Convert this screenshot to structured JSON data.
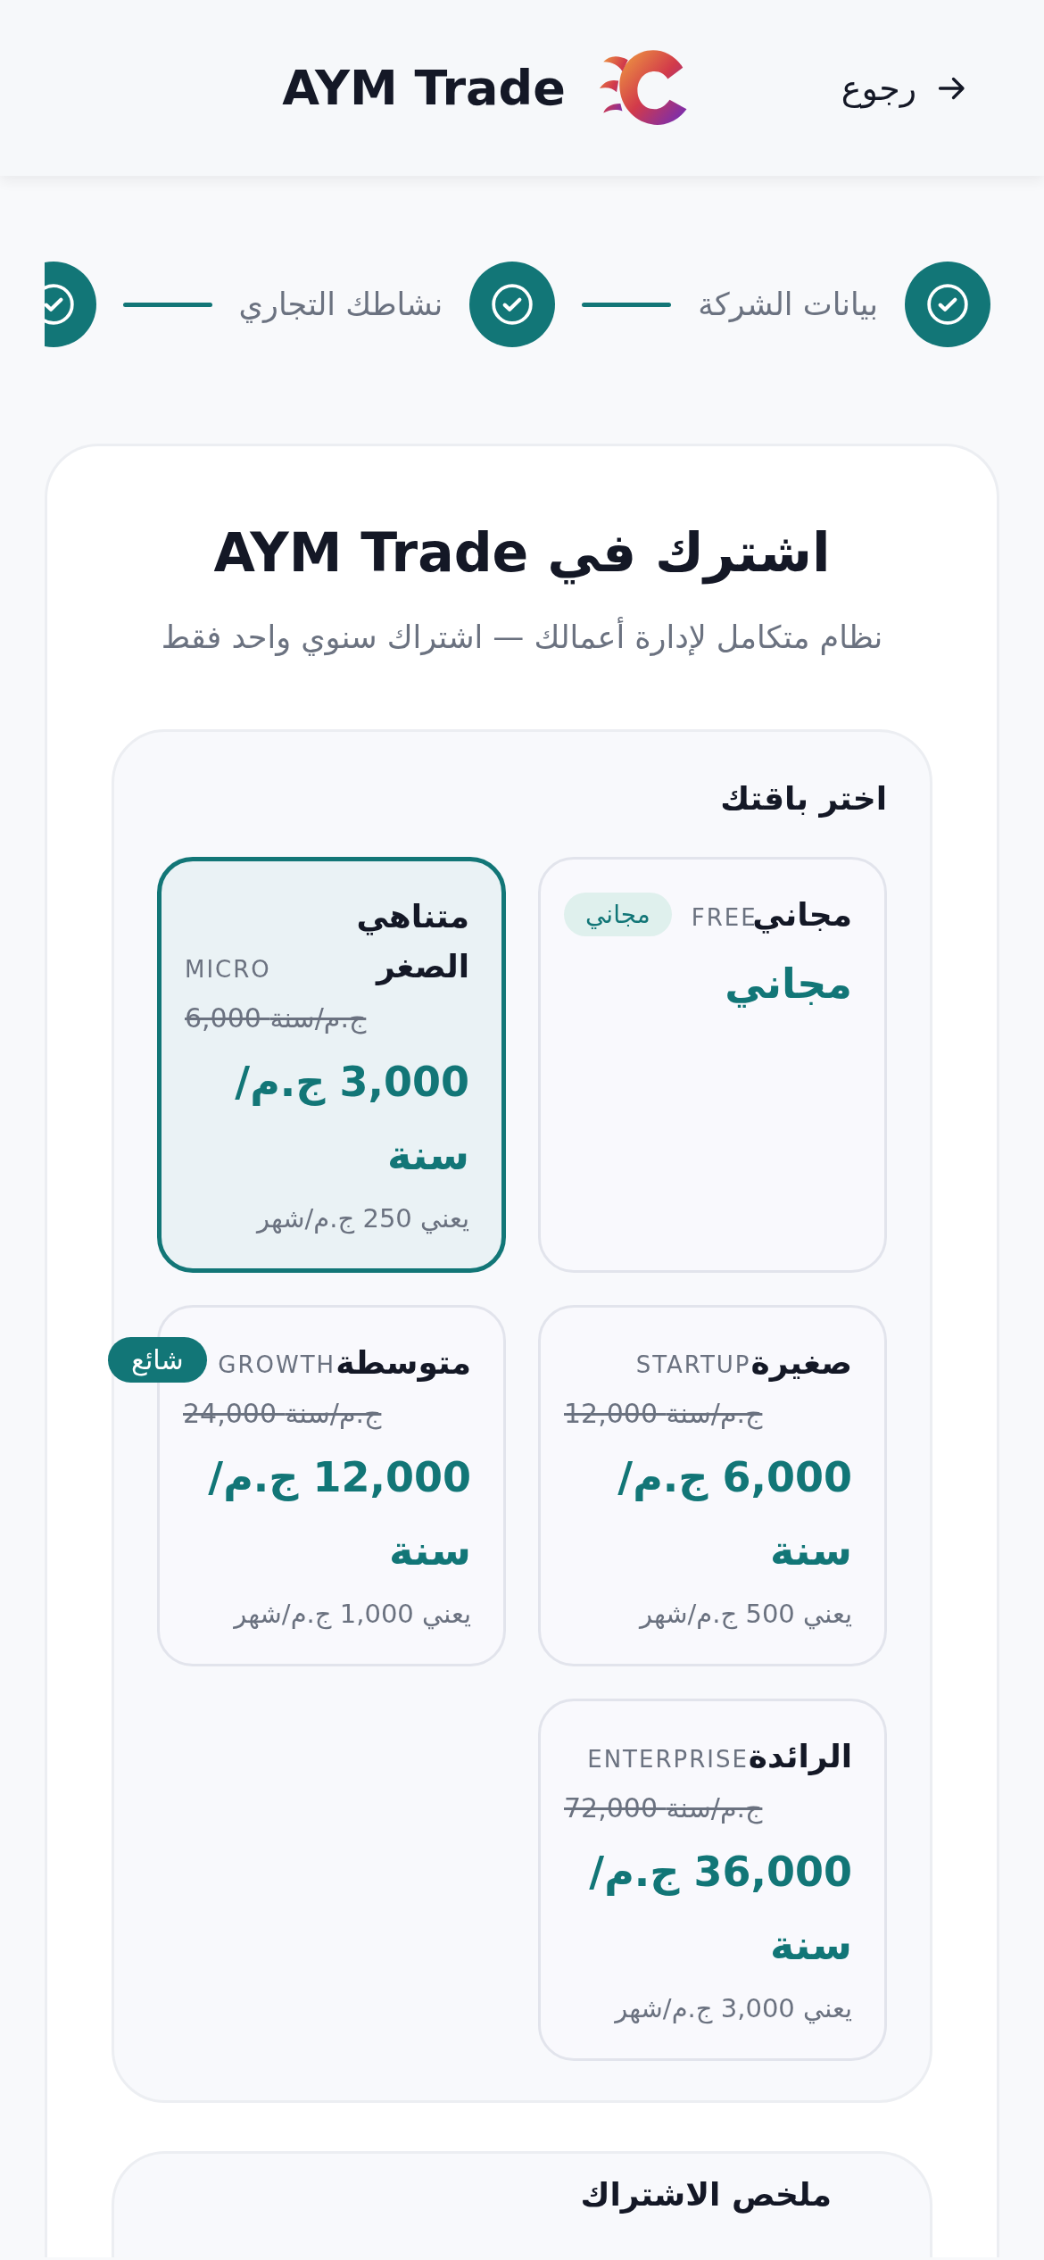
{
  "header": {
    "back_label": "رجوع",
    "brand": "AYM Trade"
  },
  "steps": [
    {
      "label": "بيانات الشركة",
      "completed": true
    },
    {
      "label": "نشاطك التجاري",
      "completed": true
    },
    {
      "completed": true
    }
  ],
  "title": "اشترك في AYM Trade",
  "subtitle": "نظام متكامل لإدارة أعمالك — اشتراك سنوي واحد فقط",
  "plans_heading": "اختر باقتك",
  "plans": [
    {
      "name": "مجاني",
      "code": "FREE",
      "badge": {
        "text": "مجاني",
        "kind": "soft"
      },
      "price": "مجاني",
      "selected": false
    },
    {
      "name": "متناهي الصغر",
      "code": "MICRO",
      "old_price": "6,000 ج.م/سنة",
      "price": "3,000 ج.م/سنة",
      "monthly": "يعني 250 ج.م/شهر",
      "selected": true
    },
    {
      "name": "صغيرة",
      "code": "STARTUP",
      "old_price": "12,000 ج.م/سنة",
      "price": "6,000 ج.م/سنة",
      "monthly": "يعني 500 ج.م/شهر",
      "selected": false
    },
    {
      "name": "متوسطة",
      "code": "GROWTH",
      "badge": {
        "text": "شائع",
        "kind": "solid"
      },
      "old_price": "24,000 ج.م/سنة",
      "price": "12,000 ج.م/سنة",
      "monthly": "يعني 1,000 ج.م/شهر",
      "selected": false
    },
    {
      "name": "الرائدة",
      "code": "ENTERPRISE",
      "old_price": "72,000 ج.م/سنة",
      "price": "36,000 ج.م/سنة",
      "monthly": "يعني 3,000 ج.م/شهر",
      "selected": false
    }
  ],
  "summary": {
    "title": "ملخص الاشتراك"
  }
}
